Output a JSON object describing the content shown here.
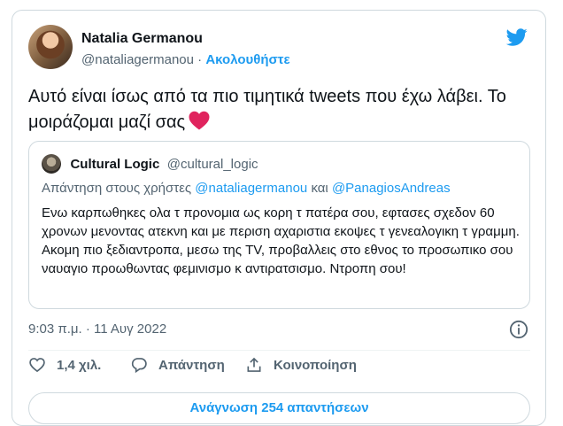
{
  "author": {
    "name": "Natalia Germanou",
    "handle": "@nataliagermanou",
    "separator": "·",
    "follow_label": "Ακολουθήστε"
  },
  "icons": {
    "brand": "twitter-bird-icon",
    "emoji": "red-heart",
    "info": "info-icon",
    "like": "heart-icon",
    "reply": "speech-bubble-icon",
    "share": "share-upload-icon"
  },
  "colors": {
    "accent": "#1d9bf0",
    "text": "#0f1419",
    "secondary": "#536471",
    "border": "#cfd9de",
    "heart": "#e0245e"
  },
  "tweet": {
    "text": "Αυτό είναι ίσως από τα πιο τιμητικά tweets που έχω λάβει. Το μοιράζομαι μαζί σας"
  },
  "quoted": {
    "name": "Cultural Logic",
    "handle": "@cultural_logic",
    "reply_prefix": "Απάντηση στους χρήστες",
    "mention_1": "@nataliagermanou",
    "reply_and": "και",
    "mention_2": "@PanagiosAndreas",
    "body": "Ενω καρπωθηκες ολα τ προνομια ως κορη τ πατέρα σου, εφτασες σχεδον 60 χρονων μενοντας ατεκνη και με περιση αχαριστια εκοψες τ γενεαλογικη τ γραμμη. Ακομη πιο ξεδιαντροπα, μεσω της TV, προβαλλεις στο εθνος το προσωπικο σου ναυαγιο προωθωντας φεμινισμο κ αντιρατσισμο. Ντροπη σου!"
  },
  "meta": {
    "timestamp": "9:03 π.μ. · 11 Αυγ 2022"
  },
  "actions": {
    "like_count": "1,4 χιλ.",
    "reply_label": "Απάντηση",
    "share_label": "Κοινοποίηση"
  },
  "footer": {
    "read_replies": "Ανάγνωση 254 απαντήσεων"
  }
}
